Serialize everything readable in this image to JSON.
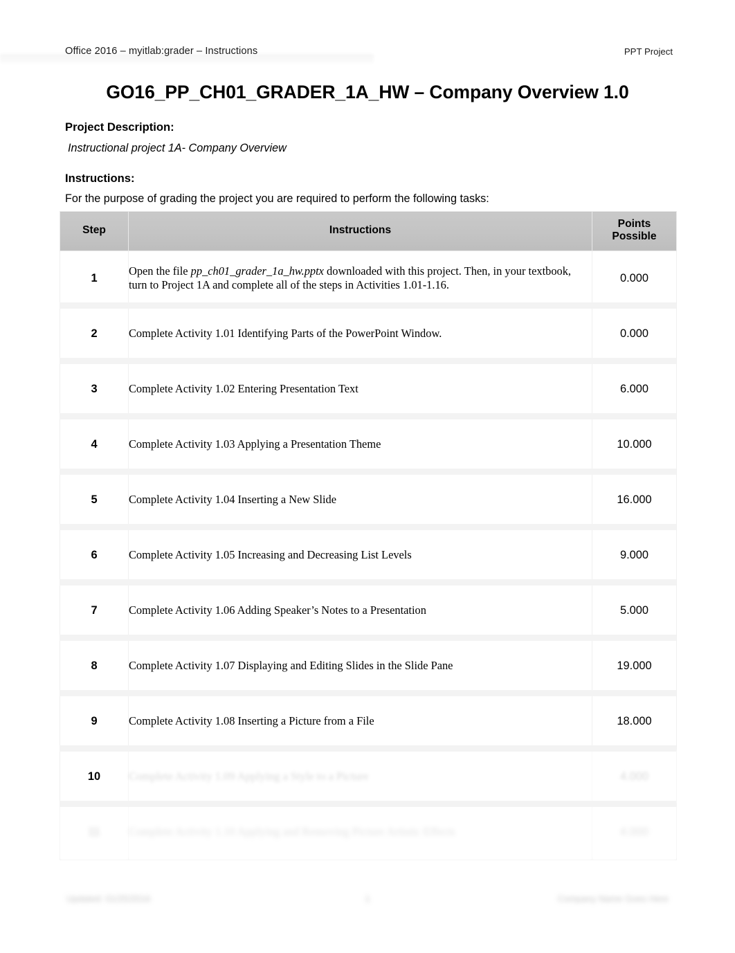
{
  "header": {
    "left": "Office 2016 – myitlab:grader – Instructions",
    "right": "PPT Project"
  },
  "title": "GO16_PP_CH01_GRADER_1A_HW – Company Overview 1.0",
  "sections": {
    "project_description_heading": "Project Description:",
    "project_description_text": "Instructional project 1A- Company Overview",
    "instructions_heading": "Instructions:",
    "instructions_text": "For the purpose of grading the project you are required to perform the following tasks:"
  },
  "table": {
    "columns": {
      "step": "Step",
      "instructions": "Instructions",
      "points_possible": "Points\nPossible",
      "points_possible_line1": "Points",
      "points_possible_line2": "Possible"
    },
    "rows": [
      {
        "step": "1",
        "instruction_pre": "Open the file ",
        "instruction_em": "pp_ch01_grader_1a_hw.pptx",
        "instruction_post": " downloaded with this project. Then, in your textbook, turn to Project 1A and complete all of the steps in Activities 1.01-1.16.",
        "points": "0.000"
      },
      {
        "step": "2",
        "instruction": "Complete Activity 1.01 Identifying Parts of the PowerPoint Window.",
        "points": "0.000"
      },
      {
        "step": "3",
        "instruction": "Complete Activity 1.02 Entering Presentation Text",
        "points": "6.000"
      },
      {
        "step": "4",
        "instruction": "Complete Activity 1.03 Applying a Presentation Theme",
        "points": "10.000"
      },
      {
        "step": "5",
        "instruction": "Complete Activity 1.04 Inserting a New Slide",
        "points": "16.000"
      },
      {
        "step": "6",
        "instruction": "Complete Activity 1.05 Increasing and Decreasing List Levels",
        "points": "9.000"
      },
      {
        "step": "7",
        "instruction": "Complete Activity 1.06 Adding Speaker’s Notes to a Presentation",
        "points": "5.000"
      },
      {
        "step": "8",
        "instruction": "Complete Activity 1.07 Displaying and Editing Slides in the Slide Pane",
        "points": "19.000"
      },
      {
        "step": "9",
        "instruction": "Complete Activity 1.08 Inserting a Picture from a File",
        "points": "18.000"
      },
      {
        "step": "10",
        "instruction": "Complete Activity 1.09 Applying a Style to a Picture",
        "points": "4.000"
      },
      {
        "step": "11",
        "instruction": "Complete Activity 1.10 Applying and Removing Picture Artistic Effects",
        "points": "4.000"
      }
    ]
  },
  "footer": {
    "left": "Updated: 01/25/2016",
    "center": "1",
    "right": "Company Name Goes Here"
  }
}
